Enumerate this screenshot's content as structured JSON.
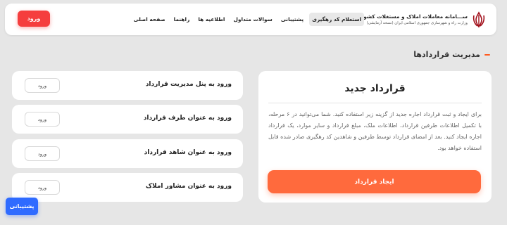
{
  "header": {
    "brand_title": "ســـامانه معاملات املاک و مستغلات کشور",
    "brand_subtitle": "وزارت راه و شهرسازی جمهوری اسلامی ایران (نسخه آزمایشی)",
    "emblem_icon": "iran-emblem-icon",
    "menu": [
      {
        "label": "صفحه اصلی"
      },
      {
        "label": "راهنما"
      },
      {
        "label": "اطلاعیه ها"
      },
      {
        "label": "سوالات متداول"
      },
      {
        "label": "پشتیبانی"
      },
      {
        "label": "استعلام کد رهگیری",
        "active": true
      }
    ],
    "login_label": "ورود"
  },
  "section": {
    "title": "مدیریت قراردادها"
  },
  "new_contract": {
    "title": "قرارداد جدید",
    "description": "برای ایجاد و ثبت قرارداد اجاره جدید از گزینه زیر استفاده کنید. شما می‌توانید در ۶ مرحله، با تکمیل اطلاعات طرفین قرارداد، اطلاعات ملک، مبلغ قرارداد و سایر موارد، یک قرارداد اجاره ایجاد کنید. بعد از امضای قرارداد توسط طرفین و شاهدین کد رهگیری صادر شده قابل استفاده خواهد بود.",
    "button_label": "ایجاد قرارداد"
  },
  "roles": [
    {
      "label": "ورود به پنل مدیریت قرارداد",
      "button": "ورود"
    },
    {
      "label": "ورود به عنوان طرف قرارداد",
      "button": "ورود"
    },
    {
      "label": "ورود به عنوان شاهد قرارداد",
      "button": "ورود"
    },
    {
      "label": "ورود به عنوان مشاور املاک",
      "button": "ورود"
    }
  ],
  "support_label": "پشتیبانی",
  "colors": {
    "login": "#f53e3e",
    "primary_action": "#ff6a3d",
    "support": "#2f6bff",
    "accent_dash": "#ff5a1f"
  }
}
